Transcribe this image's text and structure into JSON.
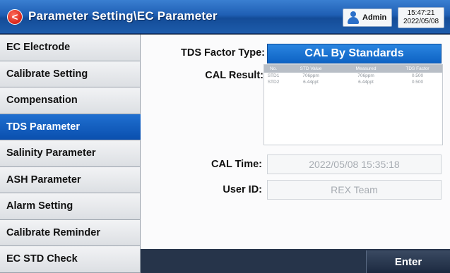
{
  "header": {
    "title": "Parameter Setting\\EC Parameter",
    "back_icon": "back-arrow-icon",
    "user": "Admin",
    "time": "15:47:21",
    "date": "2022/05/08"
  },
  "sidebar": {
    "items": [
      {
        "label": "EC Electrode",
        "active": false
      },
      {
        "label": "Calibrate Setting",
        "active": false
      },
      {
        "label": "Compensation",
        "active": false
      },
      {
        "label": "TDS Parameter",
        "active": true
      },
      {
        "label": "Salinity Parameter",
        "active": false
      },
      {
        "label": "ASH Parameter",
        "active": false
      },
      {
        "label": "Alarm Setting",
        "active": false
      },
      {
        "label": "Calibrate Reminder",
        "active": false
      },
      {
        "label": "EC STD Check",
        "active": false
      }
    ]
  },
  "main": {
    "factor_type_label": "TDS Factor Type:",
    "factor_type_value": "CAL By Standards",
    "cal_result_label": "CAL Result:",
    "cal_table": {
      "headers": [
        "No.",
        "STD Value",
        "Measured",
        "TDS Factor"
      ],
      "rows": [
        [
          "STD1",
          "706ppm",
          "706ppm",
          "0.500"
        ],
        [
          "STD2",
          "6.44ppt",
          "6.44ppt",
          "0.500"
        ]
      ]
    },
    "cal_time_label": "CAL Time:",
    "cal_time_value": "2022/05/08  15:35:18",
    "user_id_label": "User ID:",
    "user_id_value": "REX Team"
  },
  "footer": {
    "enter_label": "Enter"
  },
  "colors": {
    "header_blue": "#1f5fb4",
    "active_blue": "#0a4fae",
    "footer_dark": "#26344a"
  }
}
